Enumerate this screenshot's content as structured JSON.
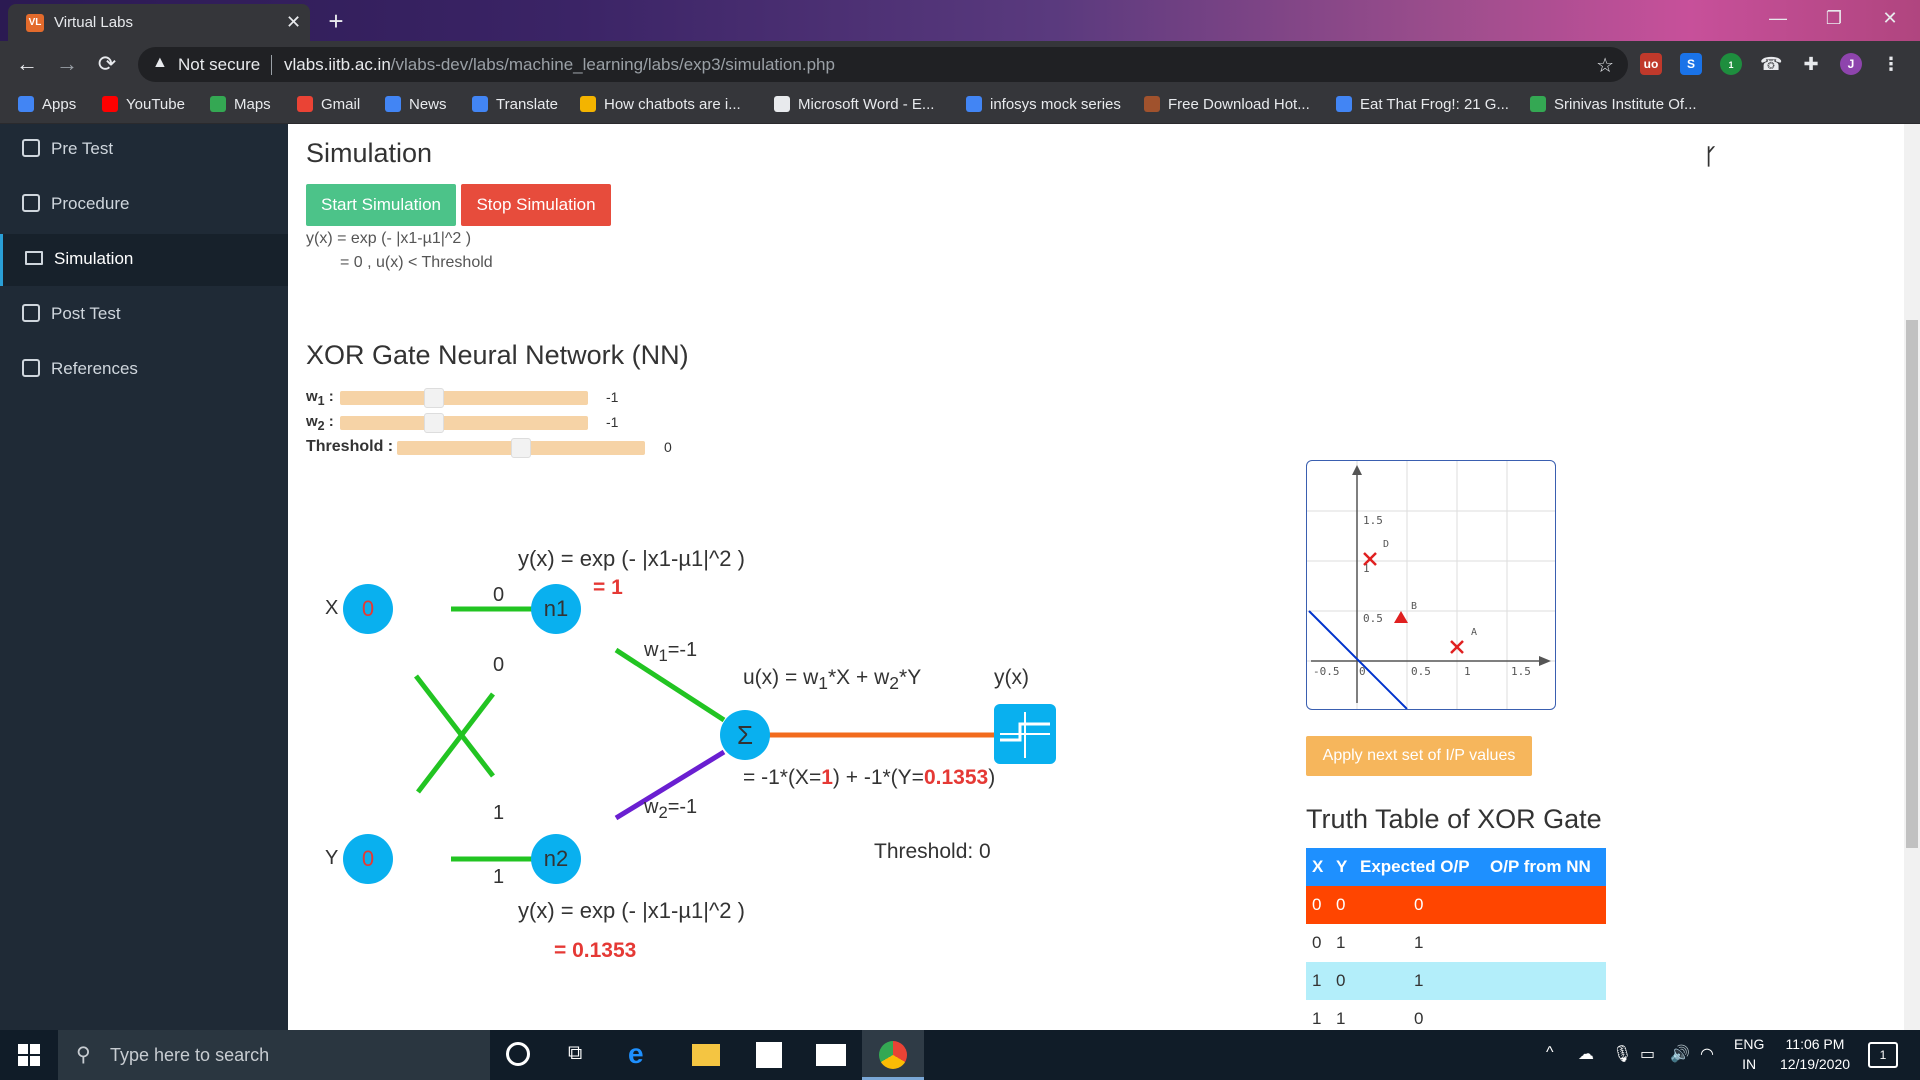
{
  "browser": {
    "tab_title": "Virtual Labs",
    "tab_close": "✕",
    "new_tab": "+",
    "not_secure": "Not secure",
    "url_host": "vlabs.iitb.ac.in",
    "url_path": "/vlabs-dev/labs/machine_learning/labs/exp3/simulation.php",
    "profile_initial": "J",
    "ext_badge": "1",
    "window_controls": {
      "minimize": "—",
      "restore": "❐",
      "close": "✕"
    }
  },
  "bookmarks": [
    {
      "label": "Apps",
      "color": "#4285f4"
    },
    {
      "label": "YouTube",
      "color": "#ff0000"
    },
    {
      "label": "Maps",
      "color": "#34a853"
    },
    {
      "label": "Gmail",
      "color": "#ea4335"
    },
    {
      "label": "News",
      "color": "#4285f4"
    },
    {
      "label": "Translate",
      "color": "#4285f4"
    },
    {
      "label": "How chatbots are i...",
      "color": "#f4b400"
    },
    {
      "label": "Microsoft Word - E...",
      "color": "#e8eaed"
    },
    {
      "label": "infosys mock series",
      "color": "#4285f4"
    },
    {
      "label": "Free Download Hot...",
      "color": "#a0522d"
    },
    {
      "label": "Eat That Frog!: 21 G...",
      "color": "#4285f4"
    },
    {
      "label": "Srinivas Institute Of...",
      "color": "#34a853"
    }
  ],
  "sidebar": {
    "items": [
      {
        "label": "Pre Test"
      },
      {
        "label": "Procedure"
      },
      {
        "label": "Simulation",
        "active": true
      },
      {
        "label": "Post Test"
      },
      {
        "label": "References"
      }
    ]
  },
  "simulation": {
    "heading": "Simulation",
    "start_label": "Start Simulation",
    "stop_label": "Stop Simulation",
    "formula_line1": "y(x) = exp (- |x1-µ1|^2 )",
    "formula_line2": "= 0 , u(x) < Threshold",
    "fork_icon": "ᚴ"
  },
  "network": {
    "title": "XOR Gate Neural Network (NN)",
    "w1_label": "w",
    "w1_sub": "1",
    "w1_value": "-1",
    "w1_level": 0.37,
    "w2_label": "w",
    "w2_sub": "2",
    "w2_value": "-1",
    "w2_level": 0.37,
    "threshold_label": "Threshold :",
    "threshold_value": "0",
    "threshold_level": 0.5,
    "x_label": "X",
    "x_value": "0",
    "y_label": "Y",
    "y_value": "0",
    "n1_label": "n1",
    "n2_label": "n2",
    "line_x_n1": "0",
    "line_x_cross": "0",
    "line_y_cross": "1",
    "line_y_n2": "1",
    "n1_formula": "y(x) = exp (- |x1-µ1|^2 )",
    "n1_result": "= 1",
    "n2_formula": "y(x) = exp (- |x1-µ1|^2 )",
    "n2_result": "= 0.1353",
    "w1_edge": "w",
    "w1_edge_sub": "1",
    "w1_edge_val": "=-1",
    "w2_edge": "w",
    "w2_edge_sub": "2",
    "w2_edge_val": "=-1",
    "sum_symbol": "Σ",
    "ux_formula_a": "u(x) = w",
    "ux_formula_s1": "1",
    "ux_formula_b": "*X + w",
    "ux_formula_s2": "2",
    "ux_formula_c": "*Y",
    "yx_label": "y(x)",
    "calc_a": "= -1*(X=",
    "calc_x": "1",
    "calc_b": ") + -1*(Y=",
    "calc_y": "0.1353",
    "calc_c": ")",
    "threshold_text": "Threshold: 0"
  },
  "plot": {
    "ticks_y": [
      "1.5",
      "1",
      "0.5"
    ],
    "ticks_x": [
      "-0.5",
      "0",
      "0.5",
      "1",
      "1.5"
    ],
    "point_labels": [
      "D",
      "B",
      "A"
    ]
  },
  "apply_label": "Apply next set of I/P values",
  "truth_table": {
    "title": "Truth Table of XOR Gate",
    "headers": [
      "X",
      "Y",
      "Expected O/P",
      "O/P from NN"
    ],
    "rows": [
      [
        "0",
        "0",
        "0",
        ""
      ],
      [
        "0",
        "1",
        "1",
        ""
      ],
      [
        "1",
        "0",
        "1",
        ""
      ],
      [
        "1",
        "1",
        "0",
        ""
      ]
    ]
  },
  "taskbar": {
    "search_placeholder": "Type here to search",
    "lang1": "ENG",
    "lang2": "IN",
    "time": "11:06 PM",
    "date": "12/19/2020",
    "notif_count": "1"
  }
}
